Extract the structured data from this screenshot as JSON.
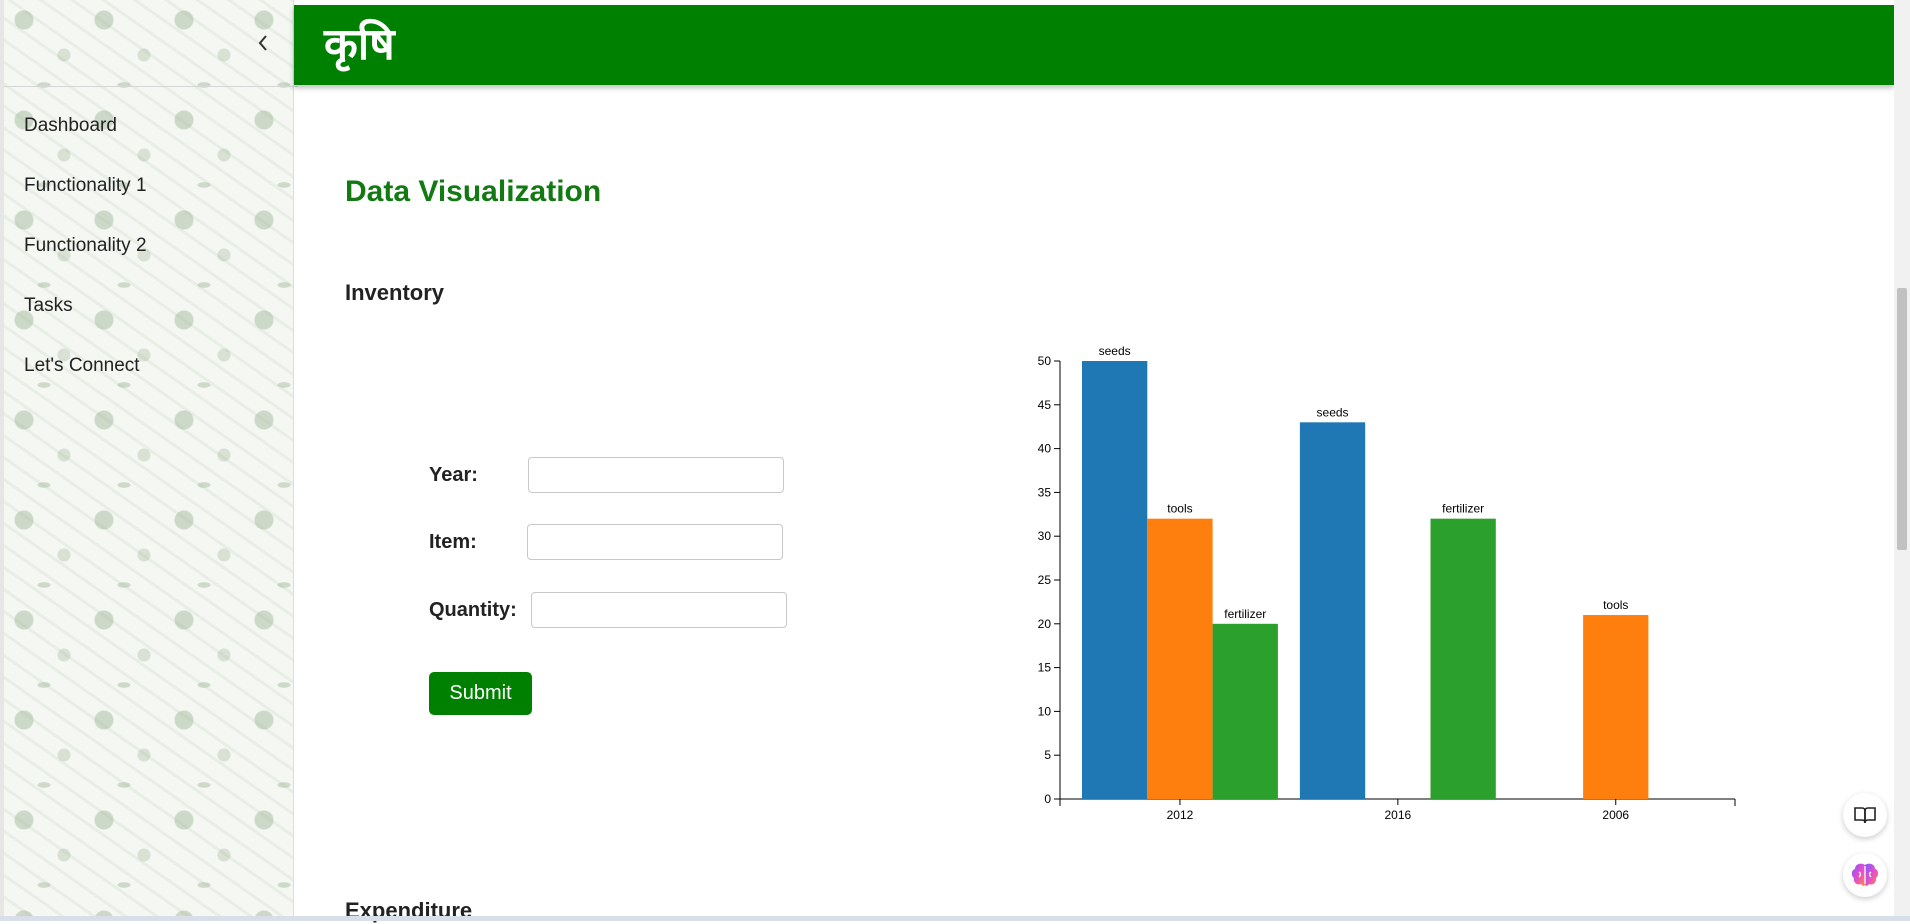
{
  "app": {
    "brand": "कृषि"
  },
  "sidebar": {
    "items": [
      {
        "label": "Dashboard"
      },
      {
        "label": "Functionality 1"
      },
      {
        "label": "Functionality 2"
      },
      {
        "label": "Tasks"
      },
      {
        "label": "Let's Connect"
      }
    ]
  },
  "main": {
    "title": "Data Visualization",
    "section": "Inventory",
    "next_section": "Expenditure"
  },
  "form": {
    "year_label": "Year:",
    "item_label": "Item:",
    "quantity_label": "Quantity:",
    "year_value": "",
    "item_value": "",
    "quantity_value": "",
    "submit_label": "Submit"
  },
  "colors": {
    "header": "#008000",
    "title": "#137a13",
    "seeds": "#1f77b4",
    "tools": "#ff7f0e",
    "fertilizer": "#2ca02c"
  },
  "chart_data": {
    "type": "bar",
    "categories": [
      "2012",
      "2016",
      "2006"
    ],
    "series": [
      {
        "name": "seeds",
        "values": [
          50,
          43,
          null
        ]
      },
      {
        "name": "tools",
        "values": [
          32,
          null,
          21
        ]
      },
      {
        "name": "fertilizer",
        "values": [
          20,
          32,
          null
        ]
      }
    ],
    "bars": [
      {
        "category": "2012",
        "label": "seeds",
        "value": 50
      },
      {
        "category": "2012",
        "label": "tools",
        "value": 32
      },
      {
        "category": "2012",
        "label": "fertilizer",
        "value": 20
      },
      {
        "category": "2016",
        "label": "seeds",
        "value": 43
      },
      {
        "category": "2016",
        "label": "fertilizer",
        "value": 32
      },
      {
        "category": "2006",
        "label": "tools",
        "value": 21
      }
    ],
    "yticks": [
      0,
      5,
      10,
      15,
      20,
      25,
      30,
      35,
      40,
      45,
      50
    ],
    "ylim": [
      0,
      50
    ],
    "grid": false
  }
}
